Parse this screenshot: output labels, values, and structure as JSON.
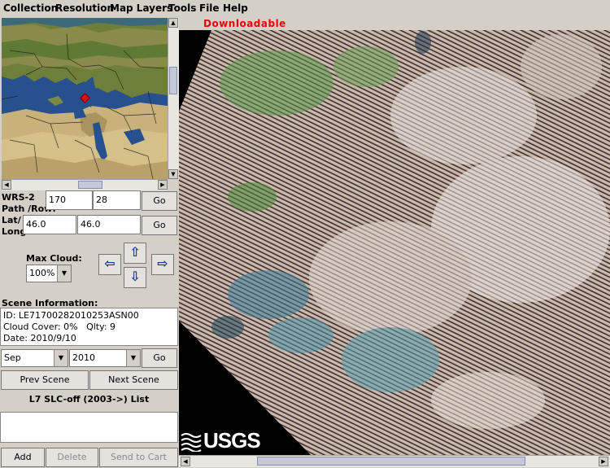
{
  "menubar": {
    "items": [
      "Collection",
      "Resolution",
      "Map Layers",
      "Tools",
      "File",
      "Help"
    ]
  },
  "status": {
    "text": "Downloadable",
    "color": "#e00000"
  },
  "search": {
    "wrs_label_1": "WRS-2",
    "wrs_label_2": "Path /Row:",
    "path_value": "170",
    "row_value": "28",
    "go_label": "Go",
    "latlong_label_1": "Lat/",
    "latlong_label_2": "Long:",
    "lat_value": "46.0",
    "long_value": "46.0"
  },
  "cloud": {
    "label": "Max Cloud:",
    "value": "100%"
  },
  "scene_info": {
    "title": "Scene Information:",
    "id_line": "ID: LE71700282010253ASN00",
    "cloud_line_a": "Cloud Cover: 0%",
    "cloud_line_b": "Qlty: 9",
    "date_line": "Date: 2010/9/10"
  },
  "date_select": {
    "month": "Sep",
    "year": "2010",
    "go_label": "Go"
  },
  "scene_nav": {
    "prev_label": "Prev Scene",
    "next_label": "Next Scene"
  },
  "list": {
    "title": "L7 SLC-off (2003->) List"
  },
  "actions": {
    "add_label": "Add",
    "delete_label": "Delete",
    "send_label": "Send to Cart"
  },
  "logo": {
    "text": "USGS"
  },
  "icons": {
    "pan_left": "arrow-left-icon",
    "pan_up": "arrow-up-icon",
    "pan_right": "arrow-right-icon",
    "pan_down": "arrow-down-icon",
    "location_marker": "location-marker-icon"
  },
  "colors": {
    "status_text": "#e00000",
    "marker": "#e01010",
    "arrow": "#1a3a8a"
  }
}
